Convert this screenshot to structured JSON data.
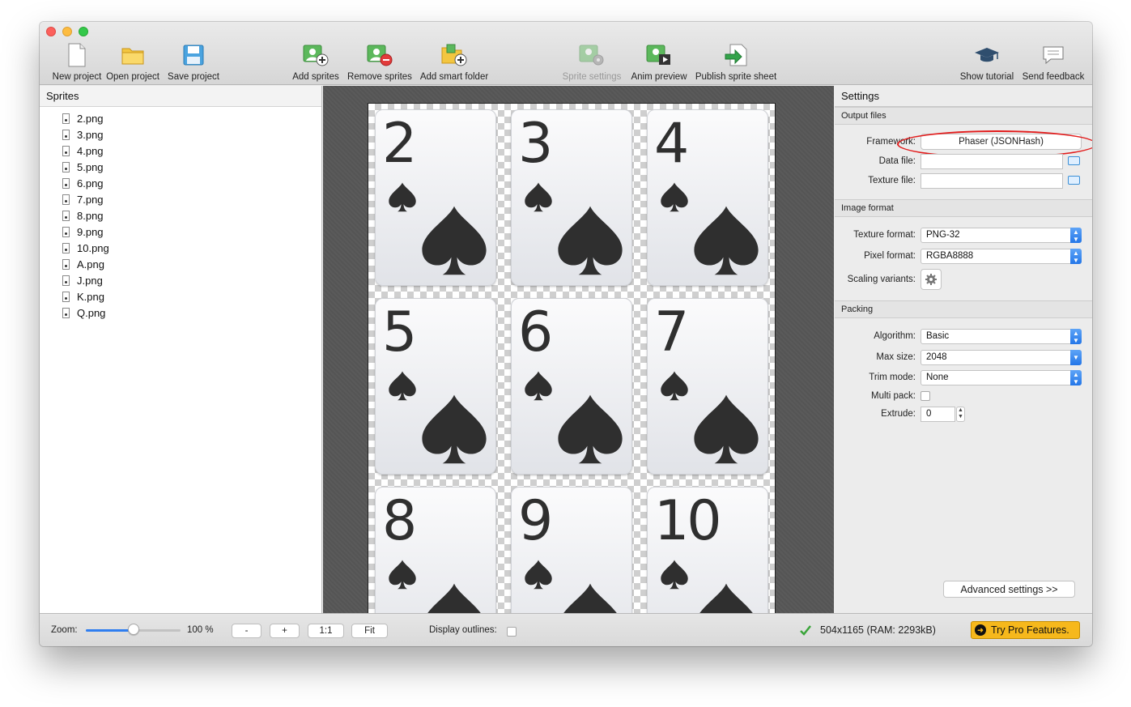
{
  "toolbar": {
    "buttons": [
      {
        "label": "New project",
        "icon": "new-document-icon"
      },
      {
        "label": "Open project",
        "icon": "folder-icon"
      },
      {
        "label": "Save project",
        "icon": "floppy-disk-icon"
      },
      {
        "label": "Add sprites",
        "icon": "add-sprites-icon"
      },
      {
        "label": "Remove sprites",
        "icon": "remove-sprites-icon"
      },
      {
        "label": "Add smart folder",
        "icon": "smart-folder-icon"
      },
      {
        "label": "Sprite settings",
        "icon": "sprite-settings-icon"
      },
      {
        "label": "Anim preview",
        "icon": "anim-preview-icon"
      },
      {
        "label": "Publish sprite sheet",
        "icon": "publish-icon"
      },
      {
        "label": "Show tutorial",
        "icon": "graduation-cap-icon"
      },
      {
        "label": "Send feedback",
        "icon": "speech-bubble-icon"
      }
    ]
  },
  "sprites_panel": {
    "title": "Sprites",
    "items": [
      "2.png",
      "3.png",
      "4.png",
      "5.png",
      "6.png",
      "7.png",
      "8.png",
      "9.png",
      "10.png",
      "A.png",
      "J.png",
      "K.png",
      "Q.png"
    ]
  },
  "canvas": {
    "cards": [
      "2",
      "3",
      "4",
      "5",
      "6",
      "7",
      "8",
      "9",
      "10"
    ]
  },
  "settings": {
    "title": "Settings",
    "output_files": {
      "section": "Output files",
      "framework_label": "Framework:",
      "framework_value": "Phaser (JSONHash)",
      "data_file_label": "Data file:",
      "data_file_value": "",
      "texture_file_label": "Texture file:",
      "texture_file_value": ""
    },
    "image_format": {
      "section": "Image format",
      "texture_format_label": "Texture format:",
      "texture_format_value": "PNG-32",
      "pixel_format_label": "Pixel format:",
      "pixel_format_value": "RGBA8888",
      "scaling_label": "Scaling variants:"
    },
    "packing": {
      "section": "Packing",
      "algorithm_label": "Algorithm:",
      "algorithm_value": "Basic",
      "max_size_label": "Max size:",
      "max_size_value": "2048",
      "trim_mode_label": "Trim mode:",
      "trim_mode_value": "None",
      "multi_pack_label": "Multi pack:",
      "extrude_label": "Extrude:",
      "extrude_value": "0"
    },
    "advanced_button": "Advanced settings >>"
  },
  "bottom_bar": {
    "zoom_label": "Zoom:",
    "zoom_value": "100 %",
    "zoom_fraction": 0.5,
    "zoom_out": "-",
    "zoom_in": "+",
    "zoom_1to1": "1:1",
    "zoom_fit": "Fit",
    "display_outlines_label": "Display outlines:",
    "status_text": "504x1165 (RAM: 2293kB)",
    "pro_button": "Try Pro Features."
  },
  "colors": {
    "highlight": "#e21b1b",
    "pro_button": "#f6b81c",
    "select_arrow": "#2f7ef0",
    "success_check": "#3aa53a"
  }
}
